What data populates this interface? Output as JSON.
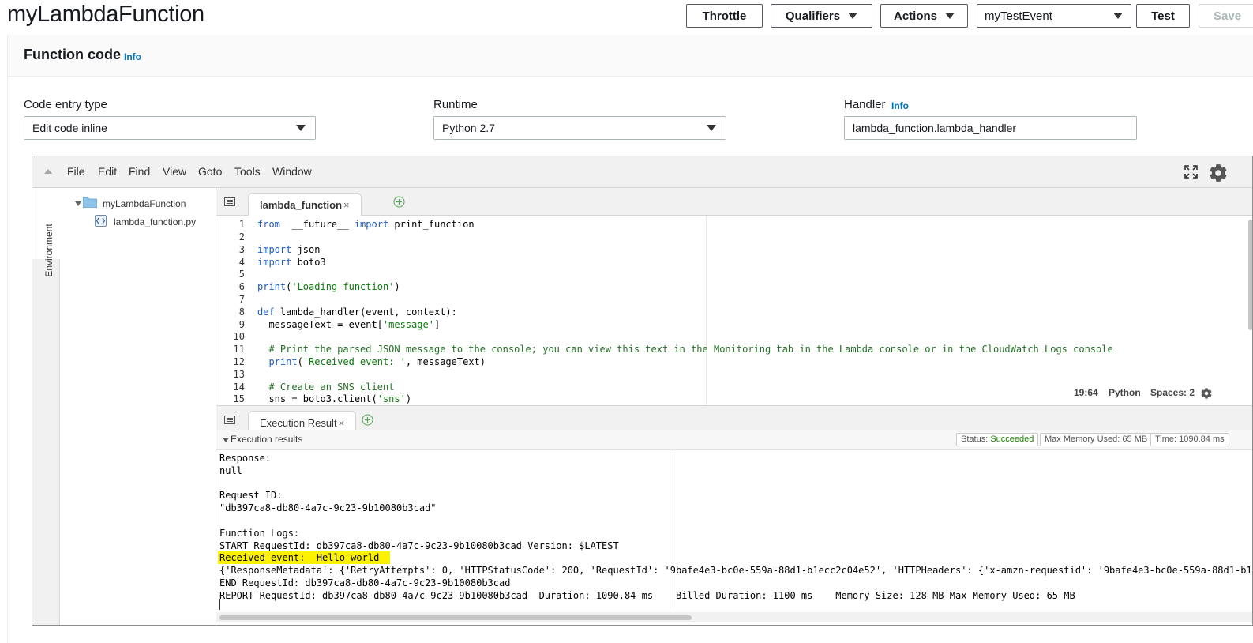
{
  "header": {
    "title": "myLambdaFunction",
    "throttle_label": "Throttle",
    "qualifiers_label": "Qualifiers",
    "actions_label": "Actions",
    "test_event_value": "myTestEvent",
    "test_label": "Test",
    "save_label": "Save"
  },
  "function_code": {
    "title": "Function code",
    "info": "Info",
    "code_entry_label": "Code entry type",
    "code_entry_value": "Edit code inline",
    "runtime_label": "Runtime",
    "runtime_value": "Python 2.7",
    "handler_label": "Handler",
    "handler_info": "Info",
    "handler_value": "lambda_function.lambda_handler"
  },
  "ide": {
    "menu": [
      "File",
      "Edit",
      "Find",
      "View",
      "Goto",
      "Tools",
      "Window"
    ],
    "environment_label": "Environment",
    "tree": {
      "folder": "myLambdaFunction",
      "file": "lambda_function.py"
    },
    "editor_tab": "lambda_function",
    "line_numbers": [
      "1",
      "2",
      "3",
      "4",
      "5",
      "6",
      "7",
      "8",
      "9",
      "10",
      "11",
      "12",
      "13",
      "14",
      "15"
    ],
    "status": {
      "position": "19:64",
      "language": "Python",
      "spaces": "Spaces: 2"
    },
    "result_tab": "Execution Result",
    "results": {
      "title": "Execution results",
      "status_label": "Status:",
      "status_value": "Succeeded",
      "memory": "Max Memory Used: 65 MB",
      "time": "Time: 1090.84 ms"
    },
    "output_lines": [
      "Response:",
      "null",
      "",
      "Request ID:",
      "\"db397ca8-db80-4a7c-9c23-9b10080b3cad\"",
      "",
      "Function Logs:",
      "START RequestId: db397ca8-db80-4a7c-9c23-9b10080b3cad Version: $LATEST",
      "Received event:  Hello world",
      "{'ResponseMetadata': {'RetryAttempts': 0, 'HTTPStatusCode': 200, 'RequestId': '9bafe4e3-bc0e-559a-88d1-b1ecc2c04e52', 'HTTPHeaders': {'x-amzn-requestid': '9bafe4e3-bc0e-559a-88d1-b1",
      "END RequestId: db397ca8-db80-4a7c-9c23-9b10080b3cad",
      "REPORT RequestId: db397ca8-db80-4a7c-9c23-9b10080b3cad  Duration: 1090.84 ms    Billed Duration: 1100 ms    Memory Size: 128 MB Max Memory Used: 65 MB"
    ]
  },
  "colors": {
    "keyword": "#1e5cbd",
    "string": "#0b7a0b",
    "comment": "#236e25",
    "highlight": "#fcf200",
    "success": "#1d8102",
    "info_link": "#0073bb"
  }
}
